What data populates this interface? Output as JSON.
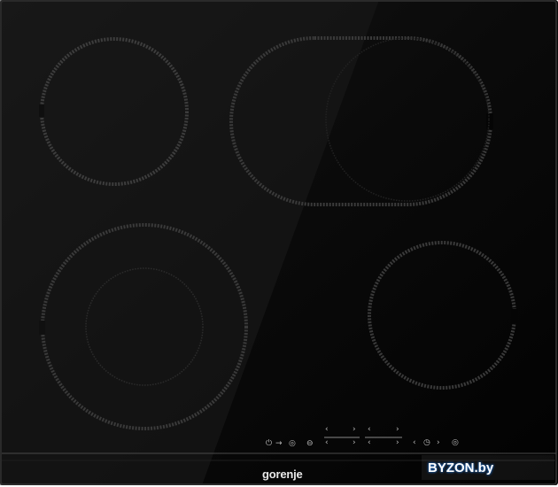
{
  "product": {
    "brand": "gorenje"
  },
  "controls": {
    "power_symbol": "⏻",
    "lock_symbol": "◎",
    "bridge_symbol": "⊖",
    "timer_symbol": "◷",
    "timer_extra_symbol": "◎",
    "arrow_left": "‹",
    "arrow_right": "›",
    "power_arrow": "→"
  },
  "watermark": {
    "text": "BYZON.by"
  },
  "colors": {
    "glass": "#050505",
    "burner_ring": "#3a3a3a",
    "watermark_glow": "#1a5fb0"
  },
  "icons": [
    "power-icon",
    "lock-icon",
    "bridge-icon",
    "timer-icon",
    "chevron-left-icon",
    "chevron-right-icon"
  ]
}
